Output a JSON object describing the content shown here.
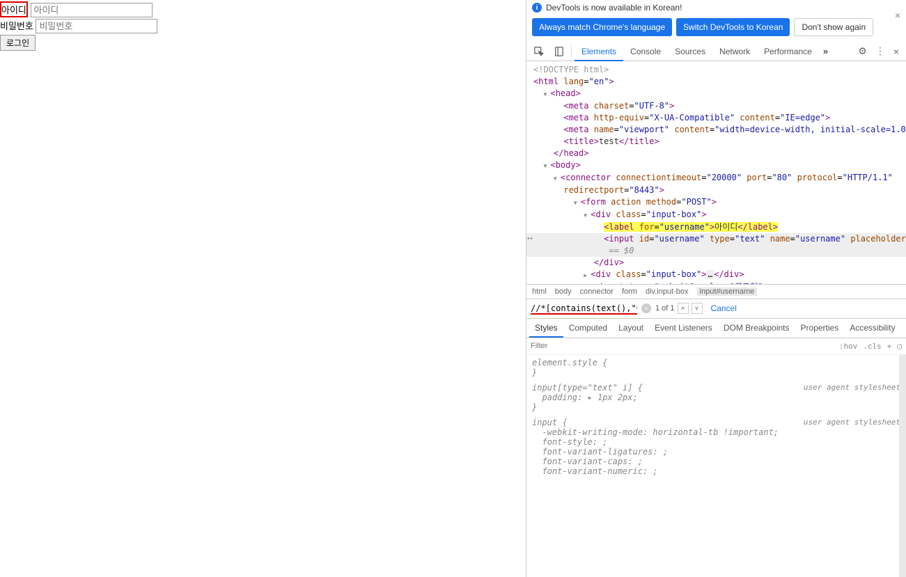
{
  "page": {
    "label_id": "아이디",
    "placeholder_id": "아이디",
    "label_pw": "비밀번호",
    "placeholder_pw": "비밀번호",
    "submit": "로그인"
  },
  "notice": {
    "text": "DevTools is now available in Korean!",
    "btn1": "Always match Chrome's language",
    "btn2": "Switch DevTools to Korean",
    "btn3": "Don't show again"
  },
  "tabs": {
    "elements": "Elements",
    "console": "Console",
    "sources": "Sources",
    "network": "Network",
    "performance": "Performance"
  },
  "dom": {
    "doctype": "<!DOCTYPE html>",
    "html_open": "html",
    "html_lang": "en",
    "head": "head",
    "meta_charset_attr": "charset",
    "meta_charset_val": "UTF-8",
    "meta_he_attr": "http-equiv",
    "meta_he_val": "X-UA-Compatible",
    "meta_content": "content",
    "meta_he_content": "IE=edge",
    "meta_vp_name": "name",
    "meta_vp_name_v": "viewport",
    "meta_vp_content": "width=device-width, initial-scale=1.0",
    "title_tag": "title",
    "title_text": "test",
    "body": "body",
    "connector": "connector",
    "conn_to": "connectiontimeout",
    "conn_to_v": "20000",
    "conn_port": "port",
    "conn_port_v": "80",
    "conn_proto": "protocol",
    "conn_proto_v": "HTTP/1.1",
    "conn_rp": "redirectport",
    "conn_rp_v": "8443",
    "form": "form",
    "form_action": "action",
    "form_method": "method",
    "form_method_v": "POST",
    "div": "div",
    "div_class": "class",
    "div_class_v": "input-box",
    "label": "label",
    "label_for": "for",
    "label_for_v": "username",
    "label_text": "아이디",
    "input": "input",
    "input_id": "id",
    "input_id_v": "username",
    "input_type": "type",
    "input_type_v": "text",
    "input_name": "name",
    "input_name_v": "username",
    "input_ph": "placeholder",
    "input_ph_v": "아이디",
    "eq0": " == $0",
    "submit_type": "submit",
    "submit_val": "value",
    "submit_val_v": "로그인"
  },
  "crumbs": {
    "c1": "html",
    "c2": "body",
    "c3": "connector",
    "c4": "form",
    "c5": "div.input-box",
    "c6": "input#username"
  },
  "search": {
    "query": "//*[contains(text(),\"아\")]",
    "count": "1 of 1",
    "cancel": "Cancel"
  },
  "stabs": {
    "s1": "Styles",
    "s2": "Computed",
    "s3": "Layout",
    "s4": "Event Listeners",
    "s5": "DOM Breakpoints",
    "s6": "Properties",
    "s7": "Accessibility"
  },
  "filter": {
    "ph": "Filter",
    "hov": ":hov",
    "cls": ".cls"
  },
  "styles": {
    "r1": "element.style {",
    "r1c": "}",
    "r2sel": "input[type=\"text\" i] {",
    "r2src": "user agent stylesheet",
    "r2p": "padding",
    "r2v": "1px 2px",
    "r3sel": "input {",
    "r3src": "user agent stylesheet",
    "p1": "-webkit-writing-mode",
    "v1": "horizontal-tb !important",
    "p2": "font-style",
    "p3": "font-variant-ligatures",
    "p4": "font-variant-caps",
    "p5": "font-variant-numeric"
  }
}
